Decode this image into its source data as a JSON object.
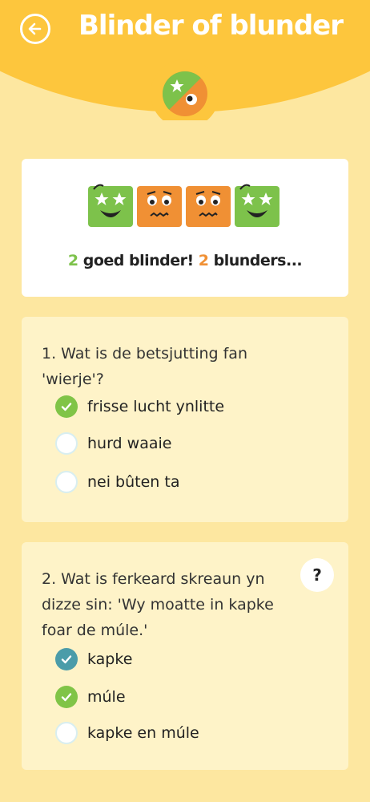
{
  "header": {
    "title": "Blinder of blunder",
    "back_icon": "arrow-left-icon",
    "logo_icon": "quiz-logo-icon",
    "colors": {
      "background": "#fdc63d",
      "text": "#ffffff"
    }
  },
  "summary": {
    "faces": [
      "star-eyes-face-icon",
      "worried-face-icon",
      "worried-face-icon",
      "star-eyes-face-icon"
    ],
    "good_count": "2",
    "good_label": "goed blinder!",
    "bad_count": "2",
    "bad_label": "blunders...",
    "colors": {
      "good": "#7dc24b",
      "bad": "#f09034"
    }
  },
  "questions": [
    {
      "text": "1. Wat is de betsjutting fan 'wierje'?",
      "options": [
        {
          "label": "frisse lucht ynlitte",
          "state": "correct"
        },
        {
          "label": "hurd waaie",
          "state": "empty"
        },
        {
          "label": "nei bûten ta",
          "state": "empty"
        }
      ]
    },
    {
      "text": "2. Wat is ferkeard skreaun yn dizze sin: 'Wy moatte in kapke foar de múle.'",
      "help_label": "?",
      "options": [
        {
          "label": "kapke",
          "state": "selected"
        },
        {
          "label": "múle",
          "state": "correct"
        },
        {
          "label": "kapke en múle",
          "state": "empty"
        }
      ]
    }
  ]
}
